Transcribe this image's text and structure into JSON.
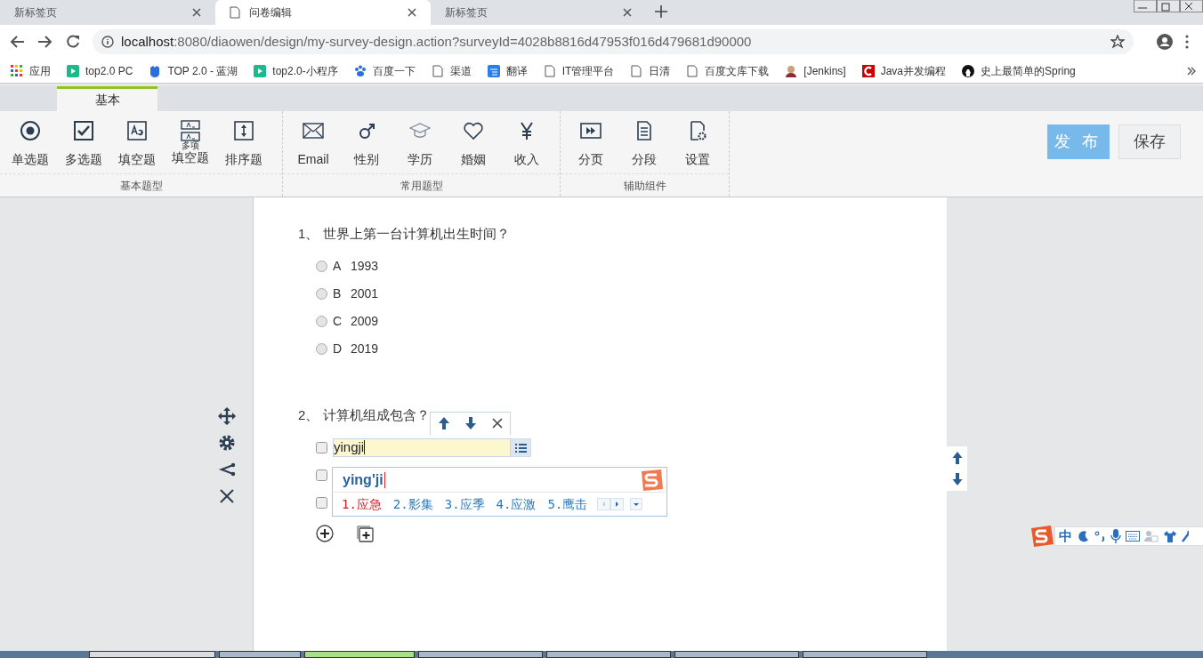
{
  "browser_tabs": [
    {
      "title": "新标签页",
      "selected": false
    },
    {
      "title": "问卷编辑",
      "selected": true
    },
    {
      "title": "新标签页",
      "selected": false
    }
  ],
  "address_bar": {
    "host": "localhost",
    "rest": ":8080/diaowen/design/my-survey-design.action?surveyId=4028b8816d47953f016d479681d90000"
  },
  "bookmarks": [
    "应用",
    "top2.0 PC",
    "TOP 2.0 - 蓝湖",
    "top2.0-小程序",
    "百度一下",
    "渠道",
    "翻译",
    "IT管理平台",
    "日清",
    "百度文库下载",
    "[Jenkins]",
    "Java并发编程",
    "史上最简单的Spring"
  ],
  "app_tabs": [
    {
      "label": "基本",
      "selected": true
    }
  ],
  "toolbar_groups": [
    {
      "title": "基本题型",
      "items": [
        {
          "label": "单选题"
        },
        {
          "label": "多选题"
        },
        {
          "label": "填空题"
        },
        {
          "label": "填空题",
          "sublabel": "多项"
        },
        {
          "label": "排序题"
        }
      ]
    },
    {
      "title": "常用题型",
      "items": [
        {
          "label": "Email"
        },
        {
          "label": "性别"
        },
        {
          "label": "学历"
        },
        {
          "label": "婚姻"
        },
        {
          "label": "收入"
        }
      ]
    },
    {
      "title": "辅助组件",
      "items": [
        {
          "label": "分页"
        },
        {
          "label": "分段"
        },
        {
          "label": "设置"
        }
      ]
    }
  ],
  "actions": [
    {
      "label": "发 布",
      "kind": "primary"
    },
    {
      "label": "保存",
      "kind": "secondary"
    }
  ],
  "questions": [
    {
      "number": "1、",
      "title": "世界上第一台计算机出生时间？",
      "kind": "radio",
      "options": [
        {
          "label": "A",
          "text": "1993",
          "checked": false
        },
        {
          "label": "B",
          "text": "2001",
          "checked": false
        },
        {
          "label": "C",
          "text": "2009",
          "checked": false
        },
        {
          "label": "D",
          "text": "2019",
          "checked": false
        }
      ]
    },
    {
      "number": "2、",
      "title": "计算机组成包含？",
      "kind": "checkbox",
      "editing": true,
      "options": [
        {
          "value": "yingji",
          "checked": false
        },
        {
          "checked": false
        },
        {
          "checked": false
        }
      ]
    }
  ],
  "ime": {
    "composition": "ying'ji",
    "candidates": [
      {
        "text": "1.应急",
        "selected": true
      },
      {
        "text": "2.影集",
        "selected": false
      },
      {
        "text": "3.应季",
        "selected": false
      },
      {
        "text": "4.应激",
        "selected": false
      },
      {
        "text": "5.鹰击",
        "selected": false
      }
    ]
  },
  "ime_status": {
    "mode": "中"
  }
}
